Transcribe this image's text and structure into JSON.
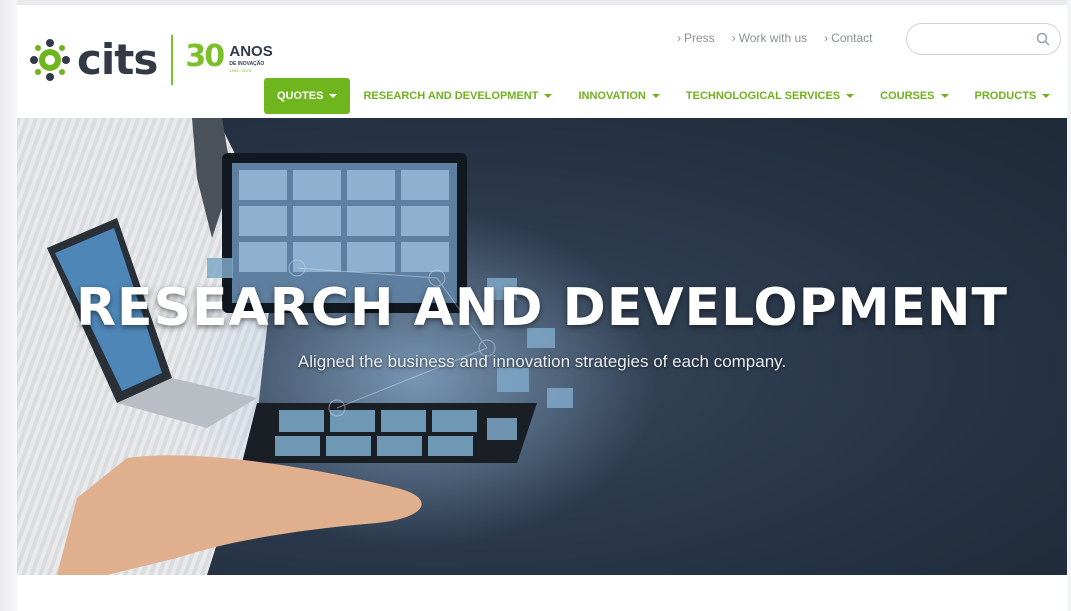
{
  "brand": {
    "name": "cits",
    "anniversary_number": "30",
    "anniversary_word": "ANOS",
    "anniversary_tagline": "DE INOVAÇÃO",
    "anniversary_years": "1993 • 2023",
    "accent_color": "#6fb51d",
    "dark_color": "#333a46"
  },
  "utility_nav": {
    "items": [
      {
        "label": "Press",
        "icon": "chevron-right-icon"
      },
      {
        "label": "Work with us",
        "icon": "chevron-right-icon"
      },
      {
        "label": "Contact",
        "icon": "chevron-right-icon"
      }
    ],
    "search": {
      "placeholder": "",
      "value": "",
      "icon": "search-icon"
    }
  },
  "main_nav": {
    "items": [
      {
        "label": "QUOTES",
        "active": true
      },
      {
        "label": "RESEARCH AND DEVELOPMENT",
        "active": false
      },
      {
        "label": "INNOVATION",
        "active": false
      },
      {
        "label": "TECHNOLOGICAL SERVICES",
        "active": false
      },
      {
        "label": "COURSES",
        "active": false
      },
      {
        "label": "PRODUCTS",
        "active": false
      }
    ],
    "language_icon": "globe-icon"
  },
  "hero": {
    "title": "RESEARCH AND DEVELOPMENT",
    "subtitle": "Aligned the business and innovation strategies of each company."
  }
}
